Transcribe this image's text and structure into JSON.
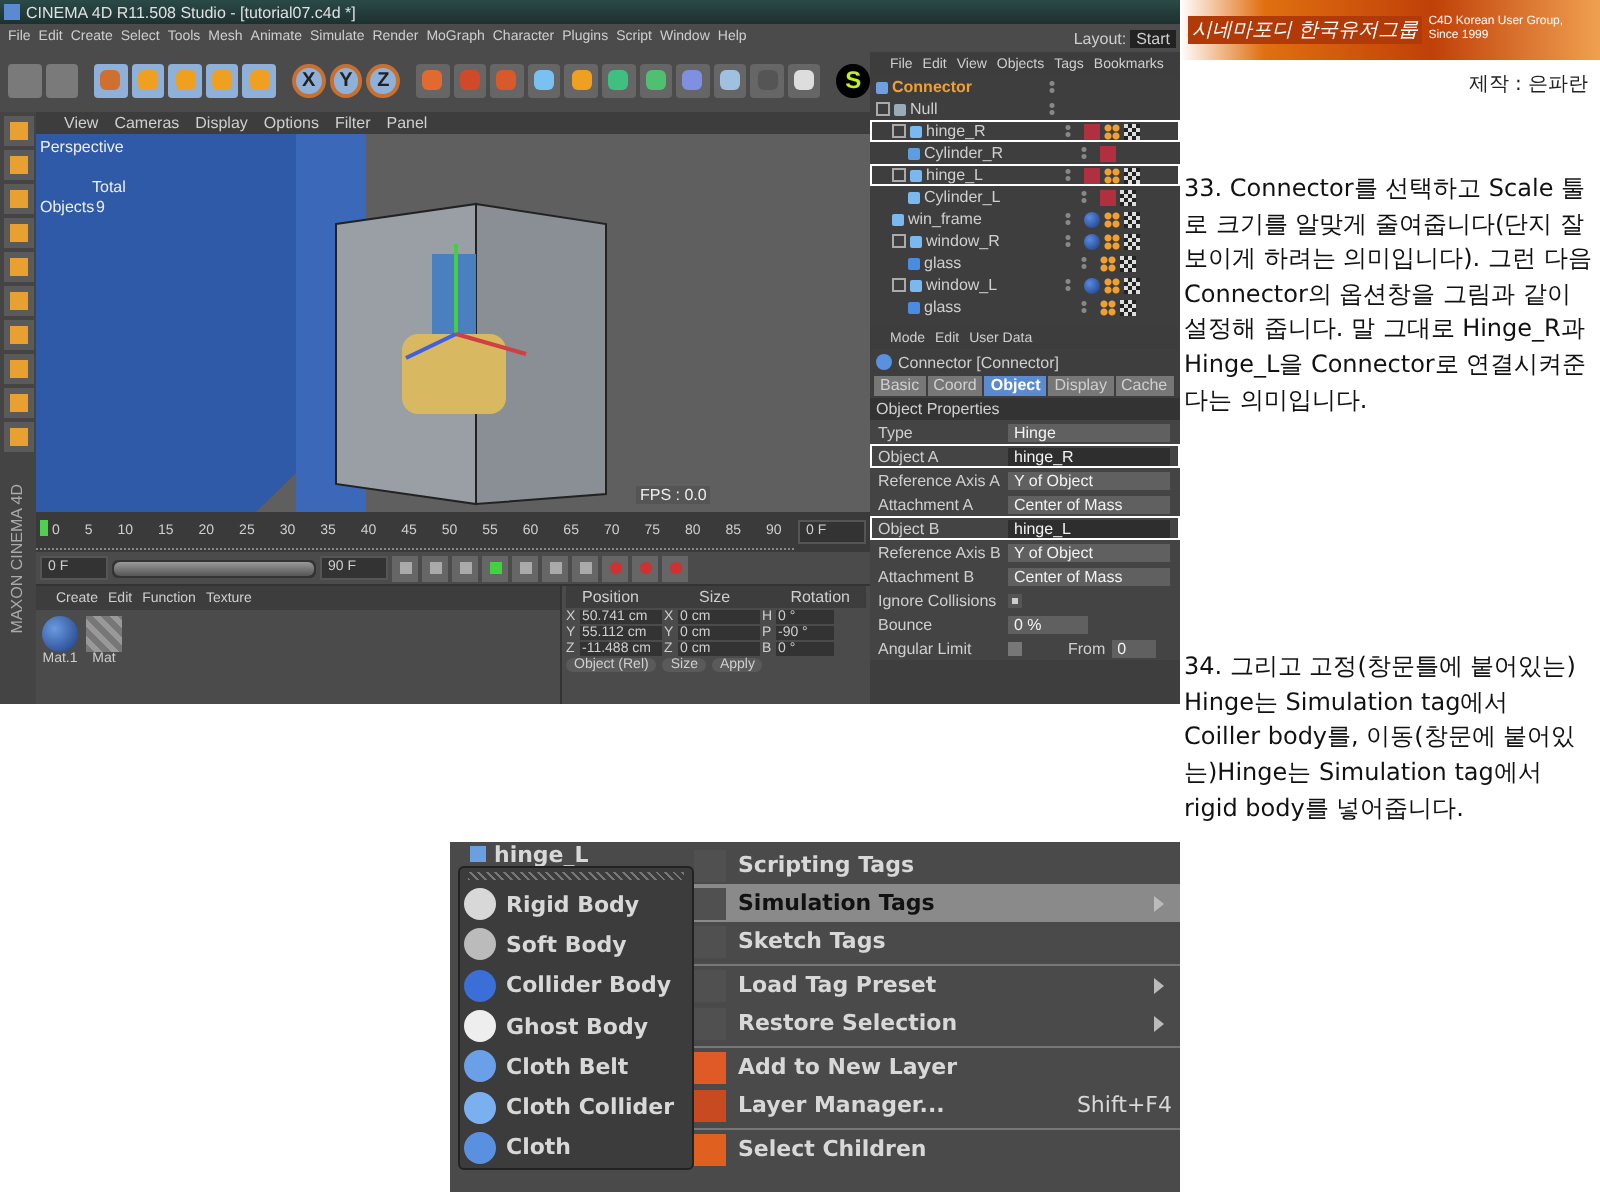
{
  "main_window": {
    "title": "CINEMA 4D R11.508 Studio - [tutorial07.c4d *]",
    "menu": [
      "File",
      "Edit",
      "Create",
      "Select",
      "Tools",
      "Mesh",
      "Animate",
      "Simulate",
      "Render",
      "MoGraph",
      "Character",
      "Plugins",
      "Script",
      "Window",
      "Help"
    ],
    "toolbar": {
      "axis_buttons": [
        "X",
        "Y",
        "Z"
      ],
      "script_badge": "S"
    },
    "viewport": {
      "menu": [
        "View",
        "Cameras",
        "Display",
        "Options",
        "Filter",
        "Panel"
      ],
      "camera": "Perspective",
      "stats_header": "Total",
      "stats_label": "Objects",
      "stats_value": "9",
      "fps": "FPS : 0.0"
    },
    "timeline": {
      "range_slider": {
        "level": 1
      },
      "ticks": [
        "0",
        "5",
        "10",
        "15",
        "20",
        "25",
        "30",
        "35",
        "40",
        "45",
        "50",
        "55",
        "60",
        "65",
        "70",
        "75",
        "80",
        "85",
        "90"
      ],
      "current_frame": "0 F",
      "level": 0,
      "start_field": "0 F",
      "end_field": "90 F"
    },
    "material_manager": {
      "menu": [
        "Create",
        "Edit",
        "Function",
        "Texture"
      ],
      "materials": [
        {
          "name": "Mat.1",
          "kind": "sphere"
        },
        {
          "name": "Mat",
          "kind": "checker"
        }
      ]
    },
    "coordinates": {
      "headers": [
        "Position",
        "Size",
        "Rotation"
      ],
      "rows": [
        {
          "axis": "X",
          "position": "50.741 cm",
          "size_axis": "X",
          "size": "0 cm",
          "rot_axis": "H",
          "rotation": "0 °"
        },
        {
          "axis": "Y",
          "position": "55.112 cm",
          "size_axis": "Y",
          "size": "0 cm",
          "rot_axis": "P",
          "rotation": "-90 °"
        },
        {
          "axis": "Z",
          "position": "-11.488 cm",
          "size_axis": "Z",
          "size": "0 cm",
          "rot_axis": "B",
          "rotation": "0 °"
        }
      ],
      "mode": "Object (Rel)",
      "size_mode": "Size",
      "apply": "Apply"
    },
    "logo": "MAXON CINEMA 4D",
    "layout": {
      "label": "Layout:",
      "value": "Start"
    },
    "object_manager": {
      "menu": [
        "File",
        "Edit",
        "View",
        "Objects",
        "Tags",
        "Bookmarks"
      ],
      "objects": [
        {
          "name": "Connector",
          "kind": "connector",
          "selected": true,
          "highlighted": false
        },
        {
          "name": "Null",
          "kind": "null",
          "selected": false,
          "highlighted": false,
          "children": [
            {
              "name": "hinge_R",
              "kind": "cone",
              "selected": false,
              "highlighted": true,
              "tags": [
                {
                  "kind": "dynamics"
                },
                {
                  "kind": "phong"
                },
                {
                  "kind": "texture"
                }
              ],
              "children": [
                {
                  "name": "Cylinder_R",
                  "kind": "cylinder",
                  "selected": false,
                  "highlighted": false,
                  "tags": [
                    {
                      "kind": "dynamics"
                    }
                  ]
                }
              ]
            },
            {
              "name": "hinge_L",
              "kind": "cone",
              "selected": false,
              "highlighted": true,
              "tags": [
                {
                  "kind": "dynamics"
                },
                {
                  "kind": "phong"
                },
                {
                  "kind": "texture"
                }
              ],
              "children": [
                {
                  "name": "Cylinder_L",
                  "kind": "cone",
                  "selected": false,
                  "highlighted": false,
                  "tags": [
                    {
                      "kind": "dynamics"
                    },
                    {
                      "kind": "texture"
                    }
                  ]
                }
              ]
            },
            {
              "name": "win_frame",
              "kind": "cone",
              "selected": false,
              "highlighted": false,
              "tags": [
                {
                  "kind": "material"
                },
                {
                  "kind": "phong"
                },
                {
                  "kind": "texture"
                }
              ]
            },
            {
              "name": "window_R",
              "kind": "cone",
              "selected": false,
              "highlighted": false,
              "tags": [
                {
                  "kind": "material"
                },
                {
                  "kind": "phong"
                },
                {
                  "kind": "texture"
                }
              ],
              "children": [
                {
                  "name": "glass",
                  "kind": "sphere",
                  "selected": false,
                  "highlighted": false,
                  "tags": [
                    {
                      "kind": "phong"
                    },
                    {
                      "kind": "texture"
                    }
                  ]
                }
              ]
            },
            {
              "name": "window_L",
              "kind": "cone",
              "selected": false,
              "highlighted": false,
              "tags": [
                {
                  "kind": "material"
                },
                {
                  "kind": "phong"
                },
                {
                  "kind": "texture"
                }
              ],
              "children": [
                {
                  "name": "glass",
                  "kind": "sphere",
                  "selected": false,
                  "highlighted": false,
                  "tags": [
                    {
                      "kind": "phong"
                    },
                    {
                      "kind": "texture"
                    }
                  ]
                }
              ]
            }
          ]
        }
      ]
    },
    "attribute_manager": {
      "menu": [
        "Mode",
        "Edit",
        "User Data"
      ],
      "title": "Connector [Connector]",
      "tabs": [
        {
          "label": "Basic",
          "selected": false
        },
        {
          "label": "Coord",
          "selected": false
        },
        {
          "label": "Object",
          "selected": true
        },
        {
          "label": "Display",
          "selected": false
        },
        {
          "label": "Cache",
          "selected": false
        }
      ],
      "section": "Object Properties",
      "fields": [
        {
          "kind": "dropdown",
          "label": "Type",
          "value": "Hinge",
          "highlighted": false
        },
        {
          "kind": "link",
          "label": "Object A",
          "value": "hinge_R",
          "highlighted": true
        },
        {
          "kind": "dropdown",
          "label": "Reference Axis A",
          "value": "Y of Object",
          "highlighted": false
        },
        {
          "kind": "dropdown",
          "label": "Attachment A",
          "value": "Center of Mass",
          "highlighted": false
        },
        {
          "kind": "link",
          "label": "Object B",
          "value": "hinge_L",
          "highlighted": true
        },
        {
          "kind": "dropdown",
          "label": "Reference Axis B",
          "value": "Y of Object",
          "highlighted": false
        },
        {
          "kind": "dropdown",
          "label": "Attachment B",
          "value": "Center of Mass",
          "highlighted": false
        },
        {
          "kind": "checkbox",
          "label": "Ignore Collisions",
          "checked": true
        },
        {
          "kind": "number",
          "label": "Bounce",
          "value": "0 %",
          "highlighted": false
        },
        {
          "kind": "checkbox_from",
          "label": "Angular Limit",
          "checked": false,
          "extra_label": "From",
          "extra_value": "0"
        }
      ]
    }
  },
  "right_panel": {
    "banner": {
      "logo_text": "시네마포디 한국유저그룹",
      "tagline": "C4D Korean User Group, Since 1999"
    },
    "credit": "제작 : 은파란",
    "steps": [
      "33. Connector를 선택하고 Scale 툴로 크기를 알맞게 줄여줍니다(단지 잘 보이게 하려는 의미입니다). 그런 다음 Connector의 옵션창을 그림과 같이 설정해 줍니다. 말 그대로 Hinge_R과 Hinge_L을 Connector로 연결시켜준다는 의미입니다.",
      "34. 그리고 고정(창문틀에 붙어있는) Hinge는 Simulation tag에서 Coiller body를, 이동(창문에 붙어있는)Hinge는 Simulation tag에서 rigid body를 넣어줍니다."
    ]
  },
  "context_screenshot": {
    "behind_row": "hinge_L",
    "submenu": [
      {
        "label": "Rigid Body",
        "kind": "rigid"
      },
      {
        "label": "Soft Body",
        "kind": "soft"
      },
      {
        "label": "Collider Body",
        "kind": "collider"
      },
      {
        "label": "Ghost Body",
        "kind": "ghost"
      },
      {
        "label": "Cloth Belt",
        "kind": "belt"
      },
      {
        "label": "Cloth Collider",
        "kind": "clothcollider"
      },
      {
        "label": "Cloth",
        "kind": "cloth"
      }
    ],
    "menu": [
      {
        "label": "Scripting Tags",
        "kind": "plain",
        "selected": false,
        "has_submenu": false,
        "separator_before": false
      },
      {
        "label": "Simulation Tags",
        "kind": "plain",
        "selected": true,
        "has_submenu": true,
        "separator_before": false
      },
      {
        "label": "Sketch Tags",
        "kind": "plain",
        "selected": false,
        "has_submenu": false,
        "separator_before": false
      },
      {
        "label": "Load Tag Preset",
        "kind": "plain",
        "selected": false,
        "has_submenu": true,
        "separator_before": true
      },
      {
        "label": "Restore Selection",
        "kind": "plain",
        "selected": false,
        "has_submenu": true,
        "separator_before": false
      },
      {
        "label": "Add to New Layer",
        "kind": "layer_add",
        "selected": false,
        "has_submenu": false,
        "separator_before": true
      },
      {
        "label": "Layer Manager...",
        "kind": "layer_manager",
        "selected": false,
        "has_submenu": false,
        "separator_before": false,
        "shortcut": "Shift+F4"
      },
      {
        "label": "Select Children",
        "kind": "select_children",
        "selected": false,
        "has_submenu": false,
        "separator_before": true
      }
    ]
  }
}
